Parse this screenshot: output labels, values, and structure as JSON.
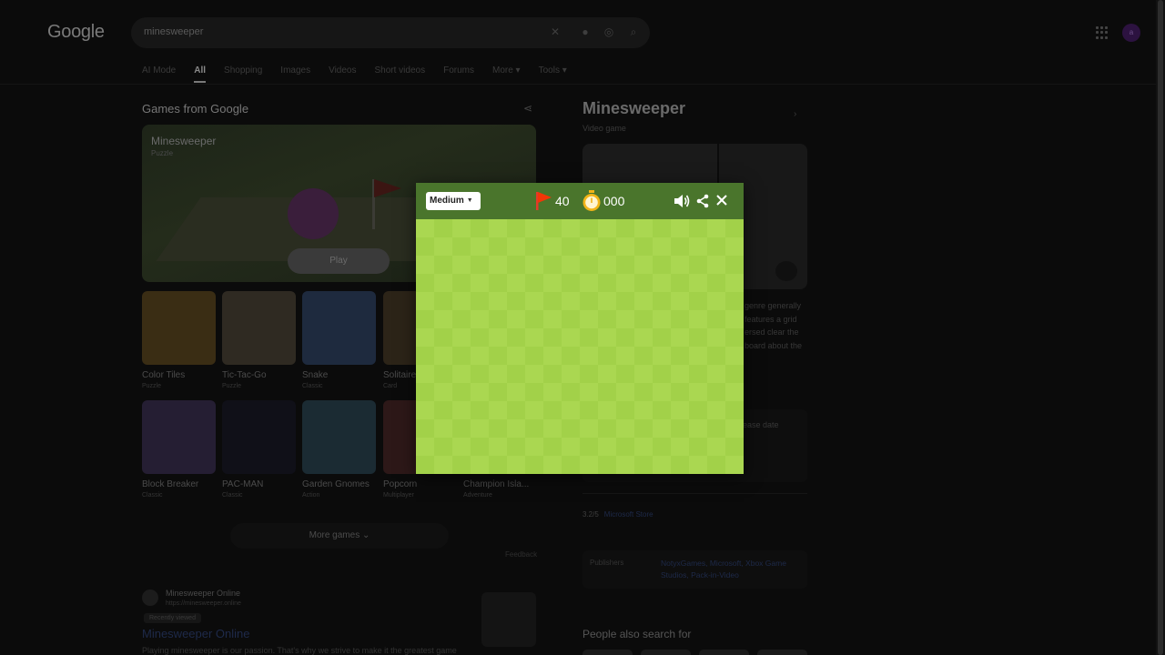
{
  "header": {
    "logo": "Google",
    "search_query": "minesweeper",
    "avatar_letter": "a",
    "tabs": [
      "AI Mode",
      "All",
      "Shopping",
      "Images",
      "Videos",
      "Short videos",
      "Forums",
      "More ▾",
      "Tools ▾"
    ]
  },
  "games": {
    "title": "Games from Google",
    "hero": {
      "name": "Minesweeper",
      "category": "Puzzle",
      "play_label": "Play"
    },
    "tiles": [
      {
        "name": "Color Tiles",
        "category": "Puzzle",
        "color": "#3a2d14"
      },
      {
        "name": "Tic-Tac-Go",
        "category": "Puzzle",
        "color": "#2f2a22"
      },
      {
        "name": "Snake",
        "category": "Classic",
        "color": "#1e2a3e"
      },
      {
        "name": "Solitaire",
        "category": "Card",
        "color": "#2c2418"
      },
      {
        "name": "Block Breaker",
        "category": "Classic",
        "color": "#251e33"
      },
      {
        "name": "PAC-MAN",
        "category": "Classic",
        "color": "#101018"
      },
      {
        "name": "Garden Gnomes",
        "category": "Action",
        "color": "#1b2b33"
      },
      {
        "name": "Popcorn",
        "category": "Multiplayer",
        "color": "#2d1818"
      },
      {
        "name": "Champion Isla...",
        "category": "Adventure",
        "color": "#1a1a1a"
      }
    ],
    "more_games": "More games",
    "feedback": "Feedback"
  },
  "result": {
    "site": "Minesweeper Online",
    "url": "https://minesweeper.online",
    "badge": "Recently viewed",
    "title": "Minesweeper Online",
    "description": "Playing minesweeper is our passion. That's why we strive to make it the greatest game"
  },
  "knowledge_panel": {
    "title": "Minesweeper",
    "subtitle": "Video game",
    "description": "genre generally features a grid ersed clear the board about the",
    "release_label": "ease date",
    "rating": "3.2/5",
    "rating_source": "Microsoft Store",
    "publishers_label": "Publishers",
    "publishers": "NotyxGames, Microsoft, Xbox Game Studios, Pack-in-Video",
    "people_also_search": "People also search for"
  },
  "game": {
    "difficulty": "Medium",
    "flags": "40",
    "timer": "000",
    "colors": {
      "bar": "#4a752c",
      "board_light": "#aad751",
      "board_dark": "#a2d149",
      "flag": "#e33a2a",
      "timer": "#f2b418"
    }
  }
}
